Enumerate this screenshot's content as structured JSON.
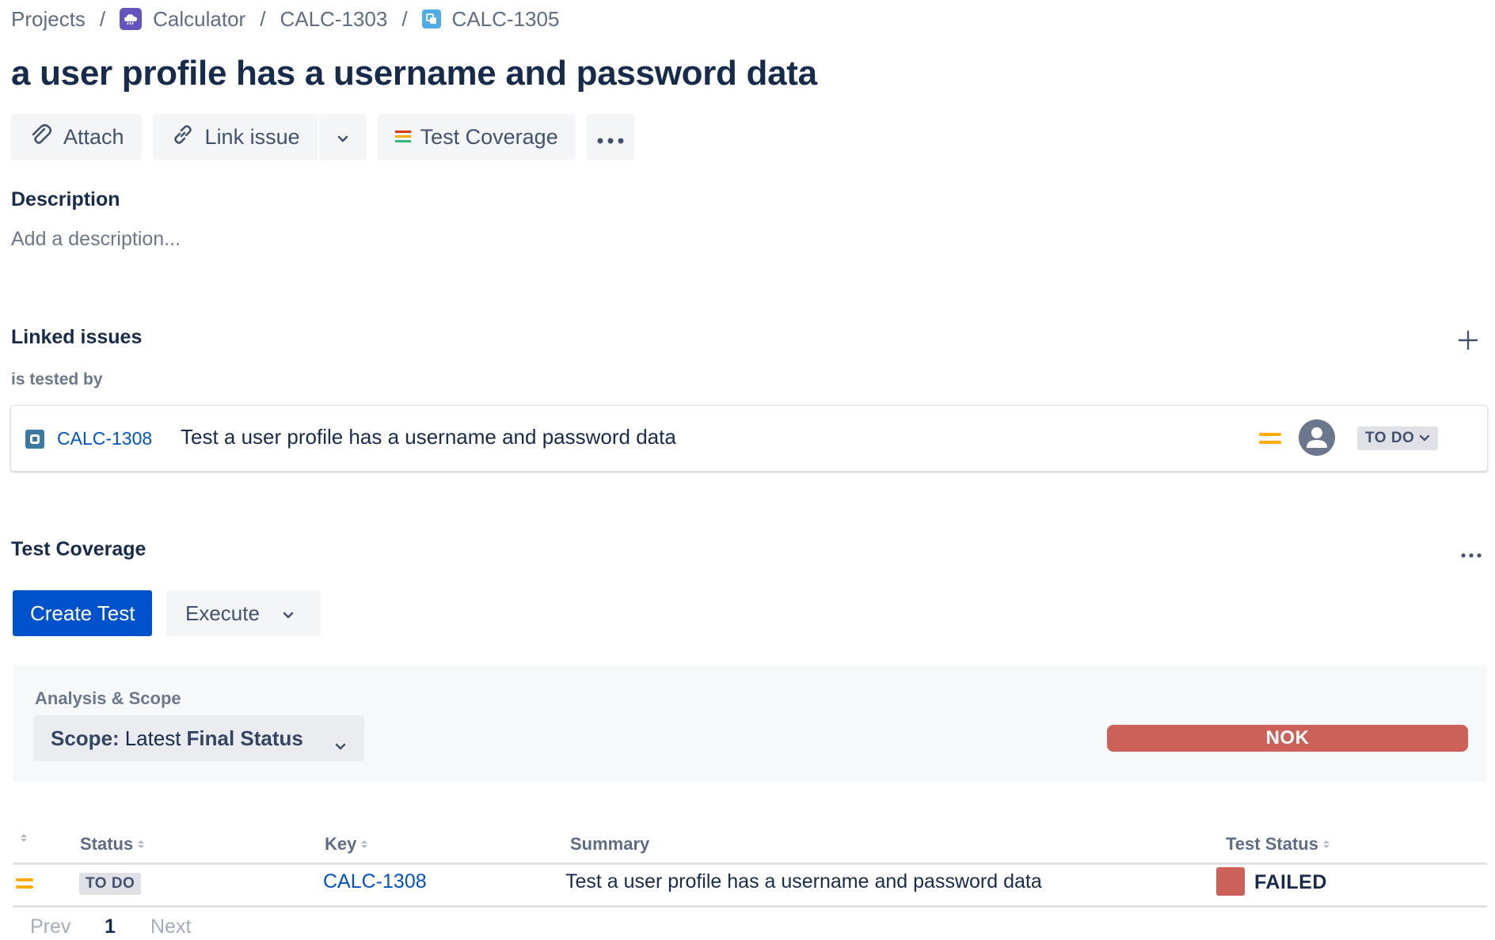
{
  "breadcrumb": {
    "projects": "Projects",
    "project": "Calculator",
    "parent": "CALC-1303",
    "current": "CALC-1305",
    "separator": "/"
  },
  "issue": {
    "title": "a user profile has a username and password data"
  },
  "toolbar": {
    "attach": "Attach",
    "link_issue": "Link issue",
    "test_coverage": "Test Coverage"
  },
  "description": {
    "heading": "Description",
    "placeholder": "Add a description..."
  },
  "linked_issues": {
    "heading": "Linked issues",
    "relation": "is tested by",
    "items": [
      {
        "key": "CALC-1308",
        "summary": "Test a user profile has a username and password data",
        "priority": "medium",
        "status": "TO DO"
      }
    ]
  },
  "test_coverage": {
    "heading": "Test Coverage",
    "create_test": "Create Test",
    "execute": "Execute",
    "analysis": {
      "label": "Analysis & Scope",
      "scope_prefix": "Scope:",
      "scope_mid": "Latest",
      "scope_value": "Final Status",
      "result": "NOK",
      "result_color": "#cc6159"
    },
    "table": {
      "columns": [
        "Status",
        "Key",
        "Summary",
        "Test Status"
      ],
      "rows": [
        {
          "priority": "medium",
          "status": "TO DO",
          "key": "CALC-1308",
          "summary": "Test a user profile has a username and password data",
          "test_status": "FAILED",
          "test_status_color": "#cc6159"
        }
      ]
    },
    "pagination": {
      "prev": "Prev",
      "page": "1",
      "next": "Next"
    }
  },
  "colors": {
    "primary": "#0052cc",
    "priority_medium": "#ffab00",
    "text": "#172b4d",
    "subtle": "#6b778c"
  }
}
